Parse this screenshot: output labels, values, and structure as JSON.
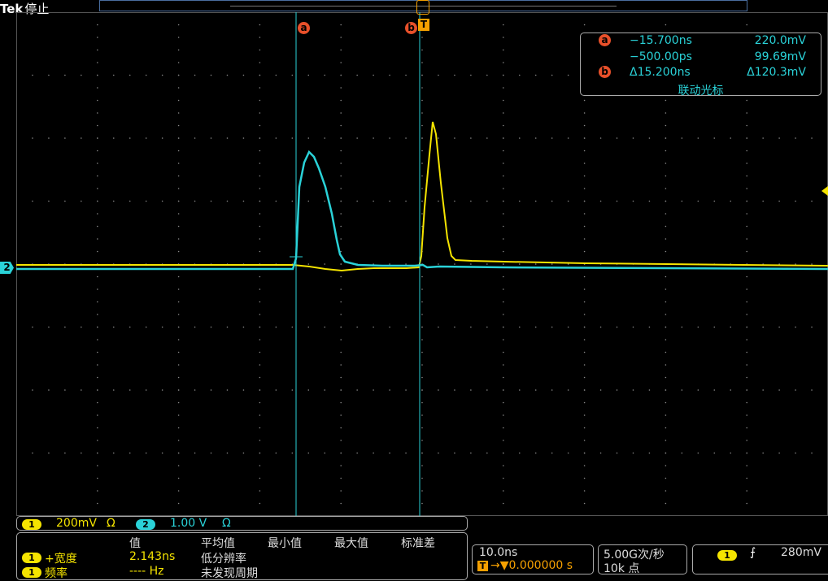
{
  "header": {
    "brand": "Tek",
    "state": "停止"
  },
  "colors": {
    "ch1": "#f5e400",
    "ch2": "#2ad2d8",
    "cursor": "#2ad2d8",
    "cursor_badge": "#e8502a",
    "grid": "#8a8a8a",
    "trigger": "#f5a000"
  },
  "cursors": {
    "a_label": "a",
    "b_label": "b",
    "t_label": "T",
    "a_time": "−15.700ns",
    "a_volt": "220.0mV",
    "b_time": "−500.00ps",
    "b_volt": "99.69mV",
    "delta_time": "Δ15.200ns",
    "delta_volt": "Δ120.3mV",
    "mode": "联动光标"
  },
  "channels": {
    "ch1_num": "1",
    "ch1_scale": "200mV",
    "ch1_coupling": "Ω",
    "ch2_num": "2",
    "ch2_scale": "1.00 V",
    "ch2_coupling": "Ω",
    "ch2_marker": "2"
  },
  "measurements": {
    "headers": [
      "值",
      "平均值",
      "最小值",
      "最大值",
      "标准差"
    ],
    "rows": [
      {
        "ch": "1",
        "name": "+宽度",
        "value": "2.143ns",
        "note": "低分辨率"
      },
      {
        "ch": "1",
        "name": "频率",
        "value": "---- Hz",
        "note": "未发现周期"
      }
    ]
  },
  "horizontal": {
    "scale": "10.0ns",
    "trig_icon": "T",
    "position": "→▼0.000000 s"
  },
  "sampling": {
    "rate": "5.00G次/秒",
    "points": "10k 点"
  },
  "trigger": {
    "ch": "1",
    "slope_icon": "rising-edge-icon",
    "slope_glyph": "⨍",
    "level": "280mV"
  }
}
